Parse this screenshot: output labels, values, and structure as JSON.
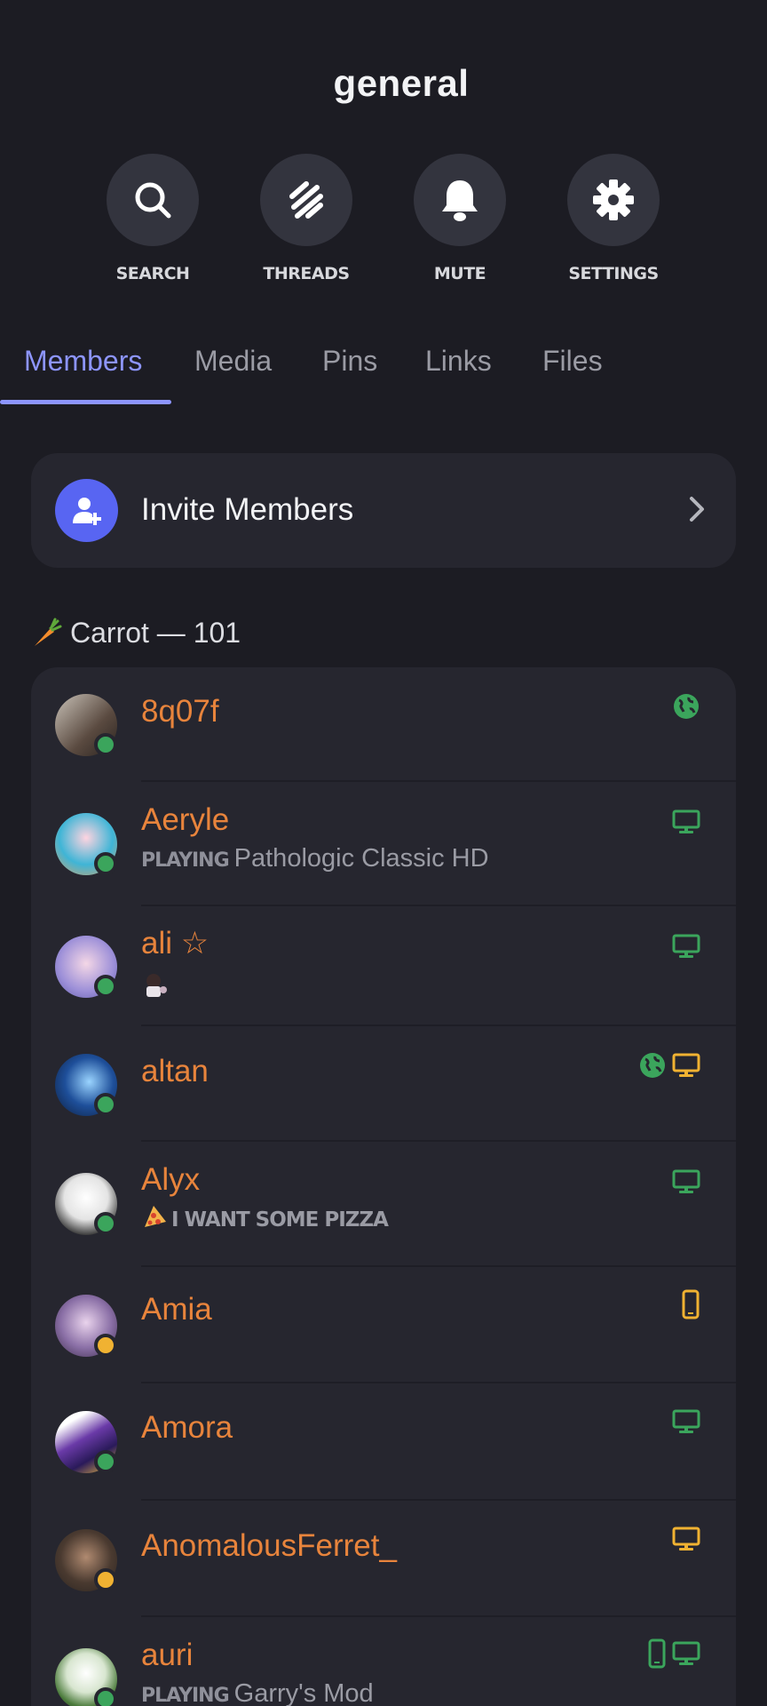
{
  "channel": {
    "title": "general"
  },
  "actions": [
    {
      "label": "SEARCH",
      "icon": "search-icon"
    },
    {
      "label": "THREADS",
      "icon": "threads-icon"
    },
    {
      "label": "MUTE",
      "icon": "bell-icon"
    },
    {
      "label": "SETTINGS",
      "icon": "gear-icon"
    }
  ],
  "tabs": [
    {
      "label": "Members",
      "active": true
    },
    {
      "label": "Media",
      "active": false
    },
    {
      "label": "Pins",
      "active": false
    },
    {
      "label": "Links",
      "active": false
    },
    {
      "label": "Files",
      "active": false
    }
  ],
  "invite": {
    "label": "Invite Members"
  },
  "group": {
    "label": "Carrot — 101",
    "emoji": "carrot"
  },
  "members": [
    {
      "name": "8q07f",
      "status": "online",
      "devices": [
        "globe"
      ],
      "activity": ""
    },
    {
      "name": "Aeryle",
      "status": "online",
      "devices": [
        "desktop"
      ],
      "activity_prefix": "PLAYING",
      "activity": "Pathologic Classic HD"
    },
    {
      "name": "ali ☆",
      "status": "online",
      "devices": [
        "desktop"
      ],
      "activity": ""
    },
    {
      "name": "altan",
      "status": "online",
      "devices": [
        "globe",
        "desktop-idle"
      ],
      "activity": ""
    },
    {
      "name": "Alyx",
      "status": "online",
      "devices": [
        "desktop"
      ],
      "activity": "I WANT SOME PIZZA"
    },
    {
      "name": "Amia",
      "status": "idle",
      "devices": [
        "mobile-idle"
      ],
      "activity": ""
    },
    {
      "name": "Amora",
      "status": "online",
      "devices": [
        "desktop"
      ],
      "activity": ""
    },
    {
      "name": "AnomalousFerret_",
      "status": "idle",
      "devices": [
        "desktop-idle"
      ],
      "activity": ""
    },
    {
      "name": "auri",
      "status": "online",
      "devices": [
        "mobile",
        "desktop"
      ],
      "activity_prefix": "PLAYING",
      "activity": "Garry's Mod"
    }
  ],
  "colors": {
    "accent": "#8d95ff",
    "online": "#3ba55c",
    "idle": "#f0b232",
    "name": "#e8843c",
    "blurple": "#5865f2"
  }
}
